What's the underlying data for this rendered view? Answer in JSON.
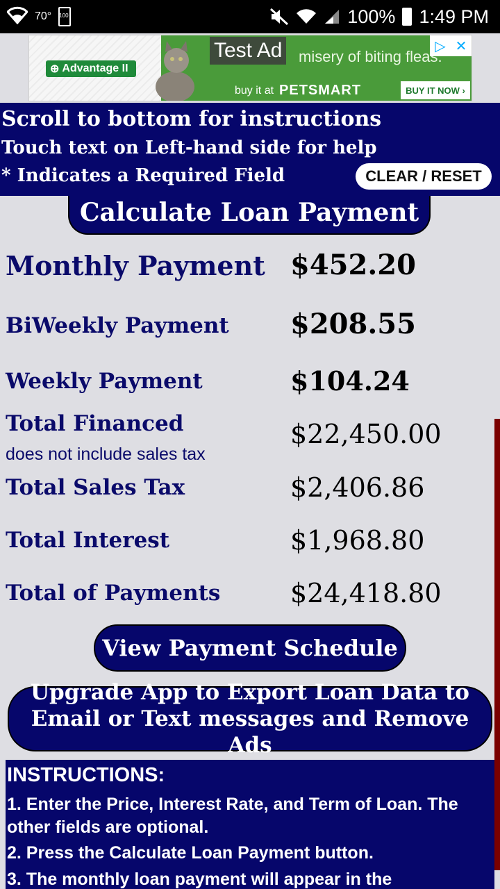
{
  "status_bar": {
    "temperature": "70°",
    "battery_small": "100",
    "battery_percent": "100%",
    "time": "1:49 PM",
    "icons": [
      "wifi-icon",
      "battery-icon",
      "mute-icon",
      "signal-icon"
    ]
  },
  "ad": {
    "brand": "Advantage II",
    "test_label": "Test Ad",
    "tagline": "misery of biting fleas.",
    "buy_prefix": "buy it at",
    "store": "PETSMART",
    "cta": "BUY IT NOW ›"
  },
  "header": {
    "line1": "Scroll to bottom for instructions",
    "line2": "Touch text on Left-hand side for help",
    "line3": "* Indicates a Required Field",
    "clear_button": "CLEAR / RESET"
  },
  "calculate_button": "Calculate Loan Payment",
  "results": {
    "monthly": {
      "label": "Monthly Payment",
      "value": "$452.20"
    },
    "biweekly": {
      "label": "BiWeekly Payment",
      "value": "$208.55"
    },
    "weekly": {
      "label": "Weekly Payment",
      "value": "$104.24"
    },
    "financed": {
      "label": "Total Financed",
      "note": "does not include sales tax",
      "value": "$22,450.00"
    },
    "sales_tax": {
      "label": "Total Sales Tax",
      "value": "$2,406.86"
    },
    "interest": {
      "label": "Total Interest",
      "value": "$1,968.80"
    },
    "payments": {
      "label": "Total of Payments",
      "value": "$24,418.80"
    }
  },
  "schedule_button": "View Payment Schedule",
  "upgrade_button": {
    "line1": "Upgrade App to Export Loan Data to",
    "line2": "Email or Text messages and Remove Ads"
  },
  "instructions": {
    "title": "INSTRUCTIONS:",
    "step1": "1. Enter the Price, Interest Rate, and Term of Loan. The other fields are optional.",
    "step2": "2. Press the Calculate Loan Payment button.",
    "step3": "3. The monthly loan payment will appear in the"
  },
  "colors": {
    "navy": "#06066b",
    "label_text": "#0a0a6a",
    "background": "#dedee3",
    "scroll_indicator": "#7a0000"
  }
}
